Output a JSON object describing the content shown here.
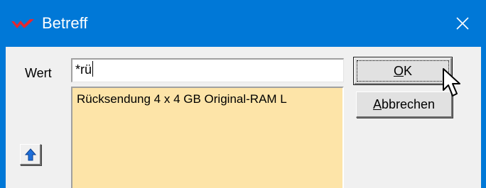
{
  "window": {
    "title": "Betreff",
    "accent_color": "#0078d7",
    "app_icon": "red-check-logo-icon",
    "close_icon": "close-icon"
  },
  "form": {
    "label": "Wert",
    "input_value": "*rü"
  },
  "results": {
    "background_color": "#fde4a8",
    "items": [
      "Rücksendung 4 x 4 GB Original-RAM L"
    ]
  },
  "buttons": {
    "ok": {
      "accel": "O",
      "rest": "K"
    },
    "cancel": {
      "accel": "A",
      "rest": "bbrechen"
    },
    "up_icon": "arrow-up-icon"
  },
  "mouse_pointer_icon": "arrow-cursor-icon"
}
